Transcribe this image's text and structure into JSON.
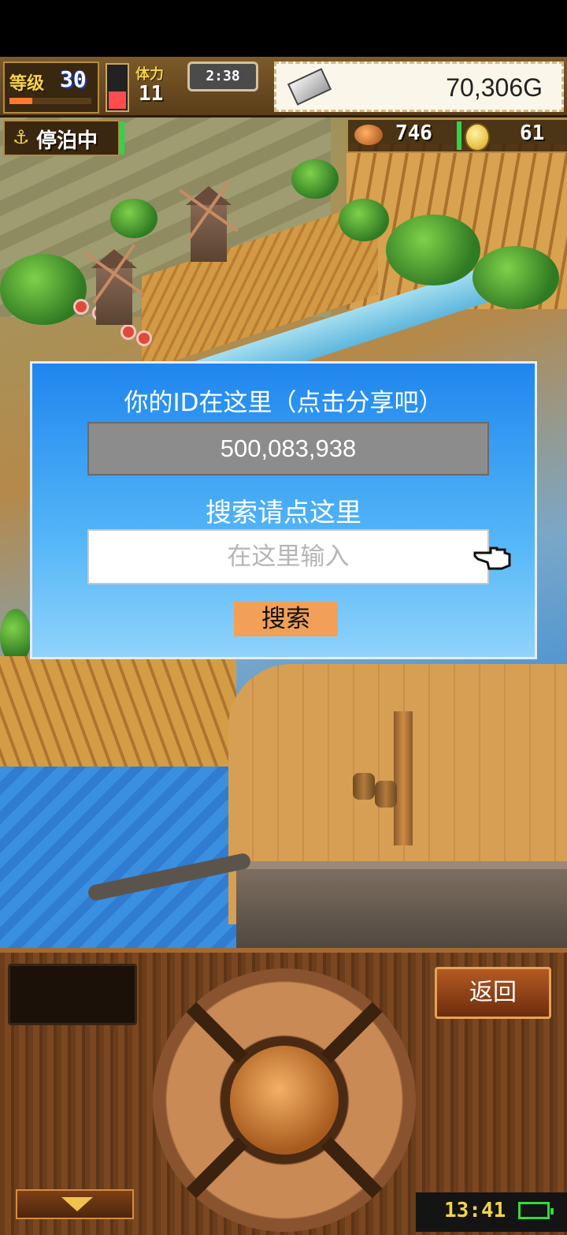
{
  "hud": {
    "level_label": "等级",
    "level_value": "30",
    "exp_fraction": 0.28,
    "stamina_label": "体力",
    "stamina_value": "11",
    "stamina_fraction": 0.4,
    "timer": "2:38",
    "money": "70,306G",
    "status_label": "停泊中",
    "food_count": "746",
    "coin_count": "61"
  },
  "dialog": {
    "title": "你的ID在这里（点击分享吧）",
    "player_id": "500,083,938",
    "search_label": "搜索请点这里",
    "search_placeholder": "在这里输入",
    "search_button": "搜索"
  },
  "controls": {
    "back_button": "返回",
    "clock": "13:41"
  },
  "colors": {
    "dialog_top": "#1f86ee",
    "dialog_bottom": "#8fd3fb",
    "search_button": "#f2a057",
    "id_box": "#8c8c8c"
  },
  "icons": [
    "silver-ingot-icon",
    "meat-icon",
    "coin-icon",
    "anchor-icon",
    "pointing-hand-icon",
    "down-arrow-icon",
    "battery-icon"
  ]
}
